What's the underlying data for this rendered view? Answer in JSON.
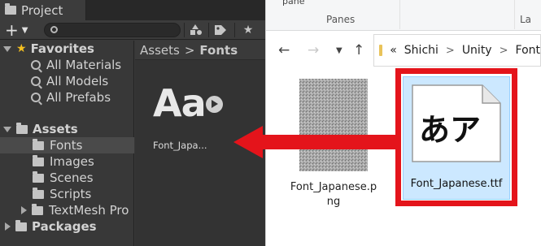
{
  "unity": {
    "tab_title": "Project",
    "add_label": "+",
    "search_placeholder": "",
    "favorites": {
      "header": "Favorites",
      "items": [
        "All Materials",
        "All Models",
        "All Prefabs"
      ]
    },
    "assets": {
      "header": "Assets",
      "items": [
        "Fonts",
        "Images",
        "Scenes",
        "Scripts",
        "TextMesh Pro"
      ],
      "selected": "Fonts"
    },
    "packages_header": "Packages",
    "breadcrumb": {
      "root": "Assets",
      "separator": ">",
      "current": "Fonts"
    },
    "asset": {
      "glyph": "Aa",
      "label": "Font_Japa..."
    }
  },
  "explorer": {
    "ribbon_pane_text": "pane",
    "ribbon_group": "Panes",
    "ribbon_group2": "La",
    "address": {
      "prefix": "«",
      "parts": [
        "Shichi",
        "Unity",
        "Font"
      ],
      "separator": ">"
    },
    "files": {
      "png": {
        "name_line1": "Font_Japanese.p",
        "name_line2": "ng"
      },
      "ttf": {
        "name": "Font_Japanese.ttf",
        "glyphs": "あア"
      }
    }
  },
  "colors": {
    "highlight": "#e4141b",
    "arrow": "#e4141b",
    "selection": "#cce8ff"
  }
}
